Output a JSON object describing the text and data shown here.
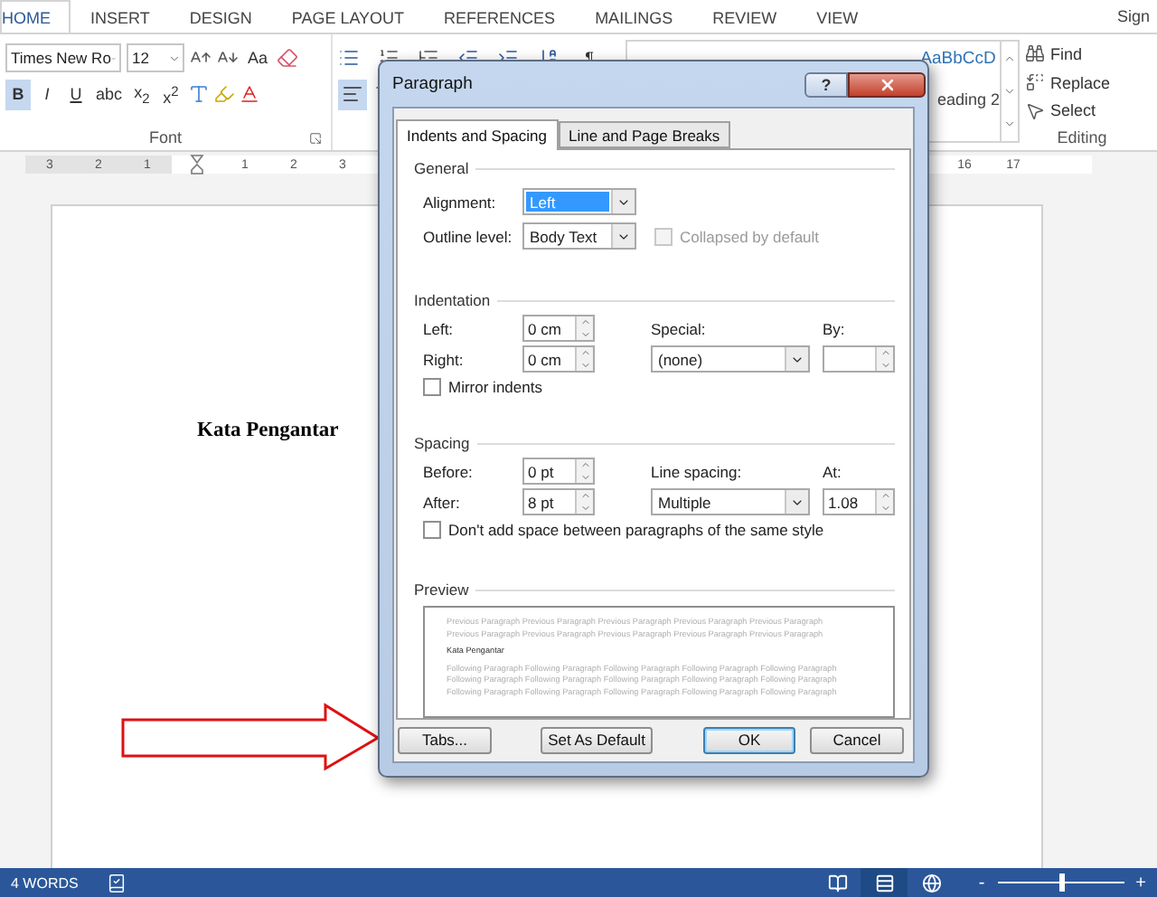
{
  "ribbon_tabs": [
    {
      "label": "HOME",
      "selected": true
    },
    {
      "label": "INSERT",
      "selected": false
    },
    {
      "label": "DESIGN",
      "selected": false
    },
    {
      "label": "PAGE LAYOUT",
      "selected": false
    },
    {
      "label": "REFERENCES",
      "selected": false
    },
    {
      "label": "MAILINGS",
      "selected": false
    },
    {
      "label": "REVIEW",
      "selected": false
    },
    {
      "label": "VIEW",
      "selected": false
    }
  ],
  "account": {
    "label": "Sign"
  },
  "font_group": {
    "font_name": "Times New Ro",
    "font_size": "12",
    "change_case": "Aa",
    "label": "Font",
    "format_buttons": [
      {
        "label": "B",
        "selected": true
      },
      {
        "label": "I",
        "selected": false
      },
      {
        "label": "U",
        "selected": false
      },
      {
        "label": "abc",
        "selected": false
      },
      {
        "label": "x$_{2}$",
        "selected": false
      },
      {
        "label": "x$^{2}$",
        "selected": false
      }
    ]
  },
  "paragraph_group": {
    "pilcrow": "¶",
    "align_left": {
      "selected": true
    }
  },
  "styles": {
    "samples": [
      {
        "text": "AaBbCcD",
        "kind": "heading"
      }
    ],
    "caption": "eading 2"
  },
  "editing": {
    "label": "Editing",
    "items": [
      {
        "label": "Find",
        "kind": "find"
      },
      {
        "label": "Replace",
        "kind": "replace"
      },
      {
        "label": "Select",
        "kind": "select"
      }
    ]
  },
  "ruler": {
    "left_labels": [
      "3",
      "2",
      "1"
    ],
    "body_labels": [
      "1",
      "2",
      "3"
    ],
    "right_labels": [
      "16",
      "17"
    ]
  },
  "document": {
    "heading": "Kata Pengantar"
  },
  "dialog": {
    "title": "Paragraph",
    "help": "?",
    "tabs": [
      {
        "label": "Indents and Spacing",
        "selected": true
      },
      {
        "label": "Line and Page Breaks",
        "selected": false
      }
    ],
    "general": {
      "title": "General",
      "alignment": {
        "label": "Alignment:",
        "value": "Left",
        "focused": true
      },
      "outline_level": {
        "label": "Outline level:",
        "value": "Body Text",
        "focused": false
      },
      "collapsed": {
        "label": "Collapsed by default",
        "checked": false,
        "disabled": true
      }
    },
    "indentation": {
      "title": "Indentation",
      "left": {
        "label": "Left:",
        "value": "0 cm"
      },
      "right": {
        "label": "Right:",
        "value": "0 cm"
      },
      "special": {
        "label": "Special:",
        "value": "(none)"
      },
      "by": {
        "label": "By:"
      },
      "mirror": {
        "label": "Mirror indents",
        "checked": false,
        "disabled": false
      }
    },
    "spacing": {
      "title": "Spacing",
      "before": {
        "label": "Before:",
        "value": "0 pt"
      },
      "after": {
        "label": "After:",
        "value": "8 pt"
      },
      "line_spacing": {
        "label": "Line spacing:",
        "value": "Multiple"
      },
      "at": {
        "label": "At:",
        "value": "1.08"
      },
      "no_space": {
        "label": "Don't add space between paragraphs of the same style",
        "checked": false,
        "disabled": false
      }
    },
    "preview": {
      "title": "Preview",
      "previous_lines": [
        "Previous Paragraph Previous Paragraph Previous Paragraph Previous Paragraph Previous Paragraph",
        "Previous Paragraph Previous Paragraph Previous Paragraph Previous Paragraph Previous Paragraph"
      ],
      "sample": "Kata Pengantar",
      "following_lines": [
        "Following Paragraph Following Paragraph Following Paragraph Following Paragraph Following Paragraph",
        "Following Paragraph Following Paragraph Following Paragraph Following Paragraph Following Paragraph",
        "Following Paragraph Following Paragraph Following Paragraph Following Paragraph Following Paragraph"
      ]
    },
    "buttons": [
      {
        "label": "Tabs...",
        "default": false
      },
      {
        "label": "Set As Default",
        "default": false
      },
      {
        "label": "OK",
        "default": true
      },
      {
        "label": "Cancel",
        "default": false
      }
    ]
  },
  "status_bar": {
    "word_count": "4 WORDS",
    "views": [
      {
        "kind": "read",
        "selected": false
      },
      {
        "kind": "print",
        "selected": true
      },
      {
        "kind": "web",
        "selected": false
      }
    ],
    "zoom_out": "-",
    "zoom_in": "+",
    "zoom": {
      "level": 0.5
    }
  }
}
